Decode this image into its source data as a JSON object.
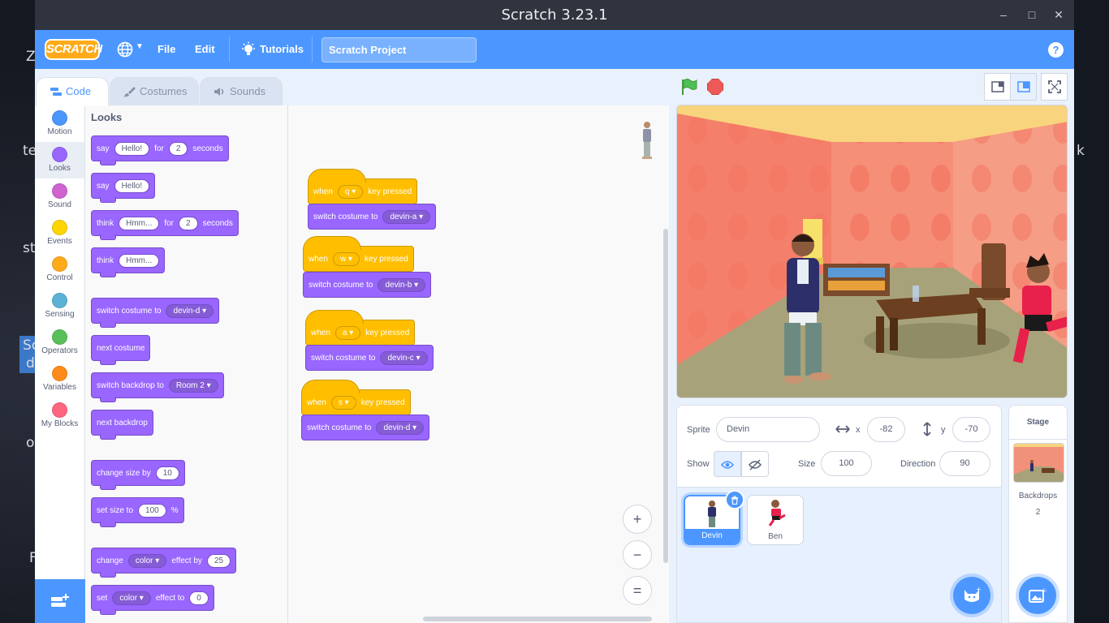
{
  "desktop": {
    "fragments": [
      "Z",
      "te",
      "st",
      "Sc",
      "d",
      "o",
      "F",
      "k",
      "s"
    ]
  },
  "window": {
    "title": "Scratch 3.23.1",
    "controls": [
      "–",
      "□",
      "✕"
    ]
  },
  "menubar": {
    "logo": "SCRATCH",
    "globe_icon": "globe-icon",
    "file": "File",
    "edit": "Edit",
    "tutorials": "Tutorials",
    "project_title": "Scratch Project",
    "help": "?"
  },
  "tabs": {
    "code": "Code",
    "costumes": "Costumes",
    "sounds": "Sounds"
  },
  "categories": [
    {
      "label": "Motion",
      "color": "#4c97ff"
    },
    {
      "label": "Looks",
      "color": "#9966ff"
    },
    {
      "label": "Sound",
      "color": "#cf63cf"
    },
    {
      "label": "Events",
      "color": "#ffd500"
    },
    {
      "label": "Control",
      "color": "#ffab19"
    },
    {
      "label": "Sensing",
      "color": "#5cb1d6"
    },
    {
      "label": "Operators",
      "color": "#59c059"
    },
    {
      "label": "Variables",
      "color": "#ff8c1a"
    },
    {
      "label": "My Blocks",
      "color": "#ff6680"
    }
  ],
  "palette": {
    "section": "Looks",
    "say_for": {
      "say": "say",
      "msg": "Hello!",
      "for": "for",
      "secs": "2",
      "seconds": "seconds"
    },
    "say": {
      "say": "say",
      "msg": "Hello!"
    },
    "think_for": {
      "think": "think",
      "msg": "Hmm...",
      "for": "for",
      "secs": "2",
      "seconds": "seconds"
    },
    "think": {
      "think": "think",
      "msg": "Hmm..."
    },
    "switch_costume": {
      "text": "switch costume to",
      "value": "devin-d"
    },
    "next_costume": "next costume",
    "switch_backdrop": {
      "text": "switch backdrop to",
      "value": "Room 2"
    },
    "next_backdrop": "next backdrop",
    "change_size": {
      "text": "change size by",
      "value": "10"
    },
    "set_size": {
      "text": "set size to",
      "value": "100",
      "pct": "%"
    },
    "change_effect": {
      "change": "change",
      "effect": "color",
      "by": "effect by",
      "value": "25"
    },
    "set_effect": {
      "set": "set",
      "effect": "color",
      "to": "effect to",
      "value": "0"
    }
  },
  "scripts": [
    {
      "when": "when",
      "key": "q",
      "pressed": "key pressed",
      "switch": "switch costume to",
      "costume": "devin-a"
    },
    {
      "when": "when",
      "key": "w",
      "pressed": "key pressed",
      "switch": "switch costume to",
      "costume": "devin-b"
    },
    {
      "when": "when",
      "key": "a",
      "pressed": "key pressed",
      "switch": "switch costume to",
      "costume": "devin-c"
    },
    {
      "when": "when",
      "key": "s",
      "pressed": "key pressed",
      "switch": "switch costume to",
      "costume": "devin-d"
    }
  ],
  "workspace": {
    "zoom_in": "+",
    "zoom_out": "−",
    "zoom_reset": "="
  },
  "sprite_info": {
    "sprite_label": "Sprite",
    "sprite_name": "Devin",
    "x_label": "x",
    "x": "-82",
    "y_label": "y",
    "y": "-70",
    "show_label": "Show",
    "size_label": "Size",
    "size": "100",
    "direction_label": "Direction",
    "direction": "90"
  },
  "sprites": [
    {
      "name": "Devin",
      "selected": true
    },
    {
      "name": "Ben",
      "selected": false
    }
  ],
  "stage_panel": {
    "title": "Stage",
    "backdrops_label": "Backdrops",
    "backdrops_count": "2"
  },
  "colors": {
    "accent": "#4c97ff",
    "looks": "#9966ff",
    "events": "#ffbf00"
  }
}
